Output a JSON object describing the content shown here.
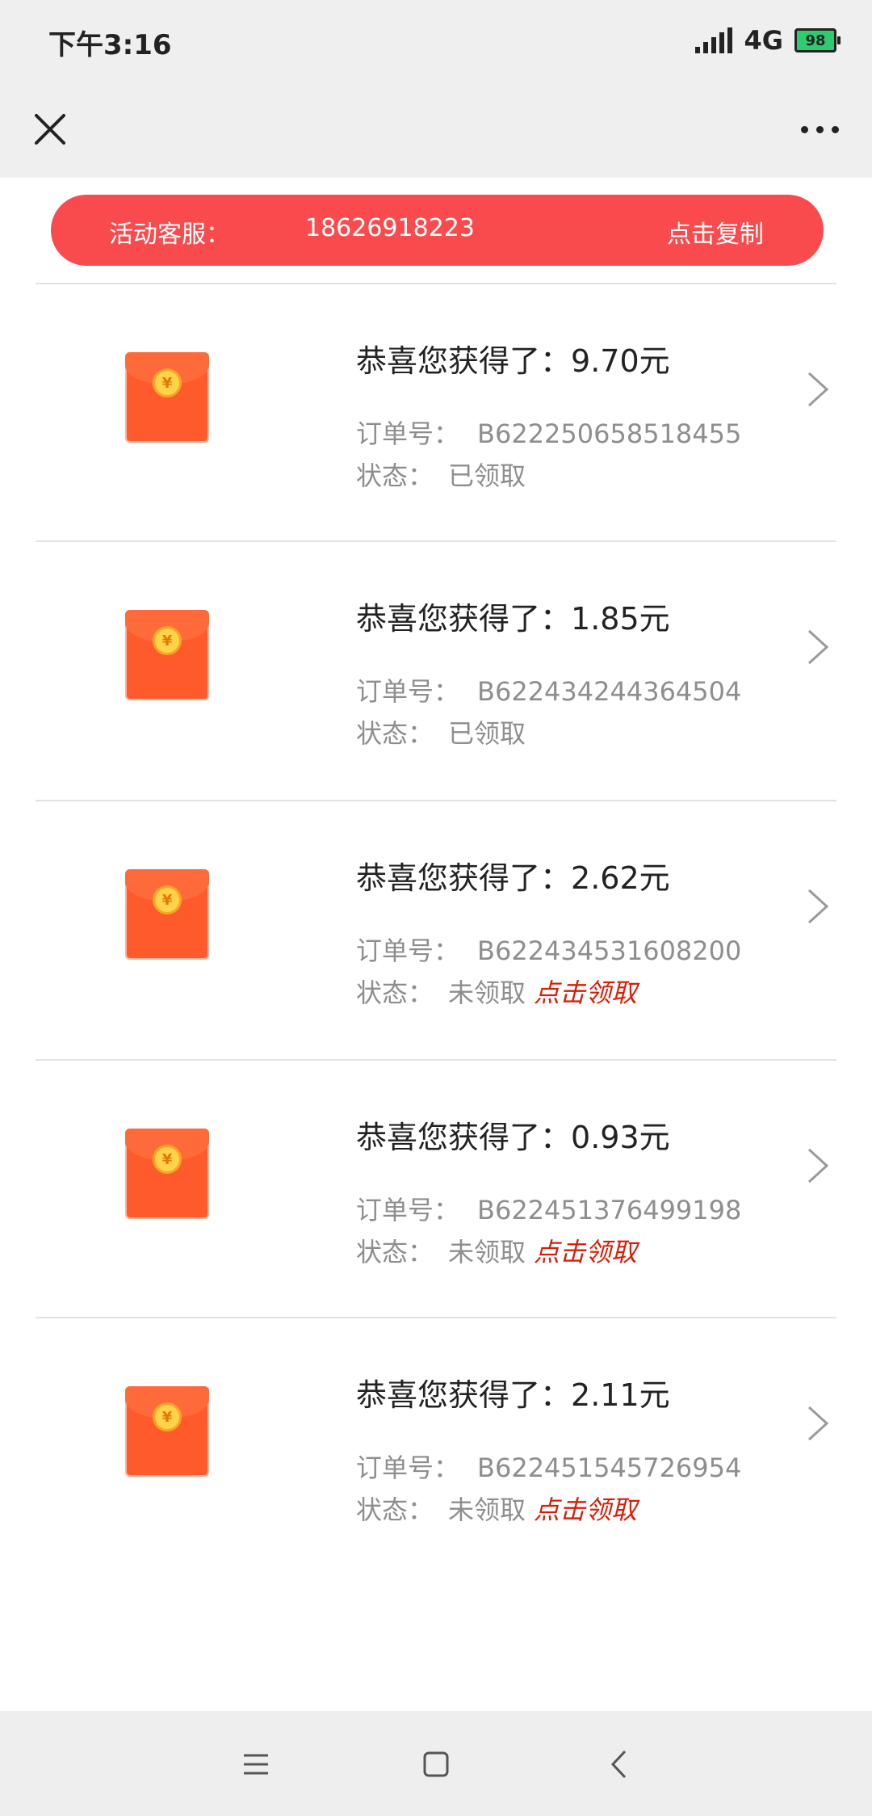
{
  "status_bar": {
    "time": "下午3:16",
    "network": "4G",
    "battery": "98"
  },
  "service": {
    "label": "活动客服：",
    "phone": "18626918223",
    "copy_label": "点击复制"
  },
  "colors": {
    "accent_red": "#f94a4d",
    "claim_red": "#d81e06",
    "envelope_red": "#ff5a2c"
  },
  "items": [
    {
      "title_prefix": "恭喜您获得了：",
      "amount": "9.70元",
      "order_label": "订单号：",
      "order_no": "B622250658518455",
      "status_label": "状态：",
      "status": "已领取",
      "claim_label": ""
    },
    {
      "title_prefix": "恭喜您获得了：",
      "amount": "1.85元",
      "order_label": "订单号：",
      "order_no": "B622434244364504",
      "status_label": "状态：",
      "status": "已领取",
      "claim_label": ""
    },
    {
      "title_prefix": "恭喜您获得了：",
      "amount": "2.62元",
      "order_label": "订单号：",
      "order_no": "B622434531608200",
      "status_label": "状态：",
      "status": "未领取",
      "claim_label": "点击领取"
    },
    {
      "title_prefix": "恭喜您获得了：",
      "amount": "0.93元",
      "order_label": "订单号：",
      "order_no": "B622451376499198",
      "status_label": "状态：",
      "status": "未领取",
      "claim_label": "点击领取"
    },
    {
      "title_prefix": "恭喜您获得了：",
      "amount": "2.11元",
      "order_label": "订单号：",
      "order_no": "B622451545726954",
      "status_label": "状态：",
      "status": "未领取",
      "claim_label": "点击领取"
    }
  ]
}
